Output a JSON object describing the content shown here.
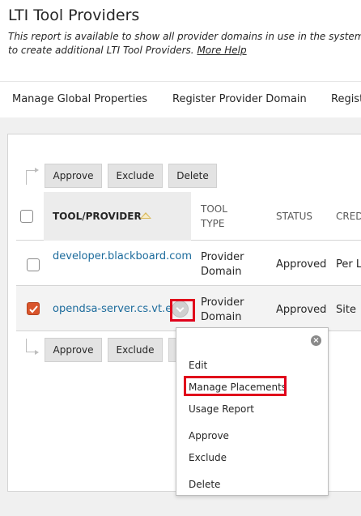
{
  "page": {
    "title": "LTI Tool Providers",
    "description": "This report is available to show all provider domains in use in the system, including",
    "description_line2": "to create additional LTI Tool Providers.",
    "more_help": "More Help"
  },
  "nav": {
    "items": [
      "Manage Global Properties",
      "Register Provider Domain",
      "Regist"
    ]
  },
  "actions": {
    "approve": "Approve",
    "exclude": "Exclude",
    "delete": "Delete"
  },
  "table": {
    "columns": {
      "tool": "TOOL/PROVIDER",
      "type_line1": "TOOL",
      "type_line2": "TYPE",
      "status": "STATUS",
      "cred": "CRED"
    },
    "rows": [
      {
        "provider": "developer.blackboard.com",
        "type_line1": "Provider",
        "type_line2": "Domain",
        "status": "Approved",
        "cred": "Per L",
        "checked": false
      },
      {
        "provider": "opendsa-server.cs.vt.edu",
        "type_line1": "Provider",
        "type_line2": "Domain",
        "status": "Approved",
        "cred": "Site",
        "checked": true
      }
    ]
  },
  "menu": {
    "close": "×",
    "items": [
      "Edit",
      "Manage Placements",
      "Usage Report",
      "Approve",
      "Exclude",
      "Delete"
    ]
  },
  "colors": {
    "link": "#1c6b9c",
    "checkbox_checked": "#d9552c",
    "highlight": "#e0001b",
    "sort_icon": "#d9b85a"
  }
}
